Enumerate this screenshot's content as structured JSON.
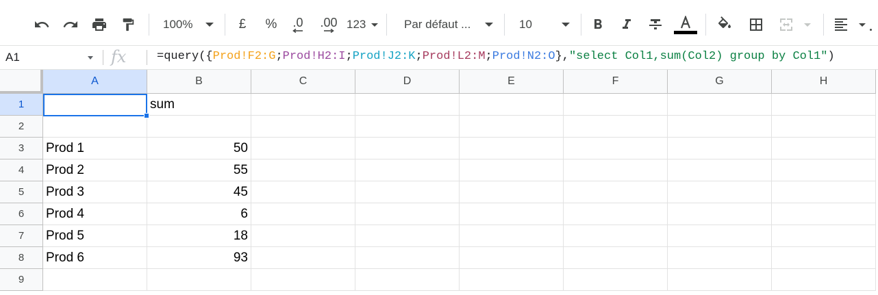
{
  "toolbar": {
    "zoom": "100%",
    "currency": "£",
    "percent": "%",
    "decrease_decimals": ".0",
    "increase_decimals": ".00",
    "more_formats": "123",
    "font_family": "Par défaut ...",
    "font_size": "10",
    "icons": [
      "undo-icon",
      "redo-icon",
      "print-icon",
      "paint-format-icon",
      "bold-icon",
      "italic-icon",
      "strikethrough-icon",
      "text-color-icon",
      "fill-color-icon",
      "borders-icon",
      "merge-cells-icon",
      "align-left-icon"
    ],
    "text_color": "#000000"
  },
  "formula_bar": {
    "cell_ref": "A1",
    "fx": "fx",
    "formula_parts": [
      {
        "text": "=query({",
        "color": "#202124"
      },
      {
        "text": "Prod!F2:G",
        "color": "#f4a21b"
      },
      {
        "text": ";",
        "color": "#202124"
      },
      {
        "text": "Prod!H2:I",
        "color": "#9b4a9f"
      },
      {
        "text": ";",
        "color": "#202124"
      },
      {
        "text": "Prod!J2:K",
        "color": "#16a3c4"
      },
      {
        "text": ";",
        "color": "#202124"
      },
      {
        "text": "Prod!L2:M",
        "color": "#a63b5e"
      },
      {
        "text": ";",
        "color": "#202124"
      },
      {
        "text": "Prod!N2:O",
        "color": "#3b7be0"
      },
      {
        "text": "},",
        "color": "#202124"
      },
      {
        "text": "\"select Col1,sum(Col2) group by Col1\"",
        "color": "#0b8043"
      },
      {
        "text": ")",
        "color": "#202124"
      }
    ]
  },
  "grid": {
    "columns": [
      "A",
      "B",
      "C",
      "D",
      "E",
      "F",
      "G",
      "H"
    ],
    "rows": [
      "1",
      "2",
      "3",
      "4",
      "5",
      "6",
      "7",
      "8",
      "9"
    ],
    "selected_cell": "A1",
    "cells": [
      [
        "",
        "sum"
      ],
      [
        "",
        ""
      ],
      [
        "Prod 1",
        "50"
      ],
      [
        "Prod 2",
        "55"
      ],
      [
        "Prod 3",
        "45"
      ],
      [
        "Prod 4",
        "6"
      ],
      [
        "Prod 5",
        "18"
      ],
      [
        "Prod 6",
        "93"
      ],
      [
        "",
        ""
      ]
    ]
  }
}
